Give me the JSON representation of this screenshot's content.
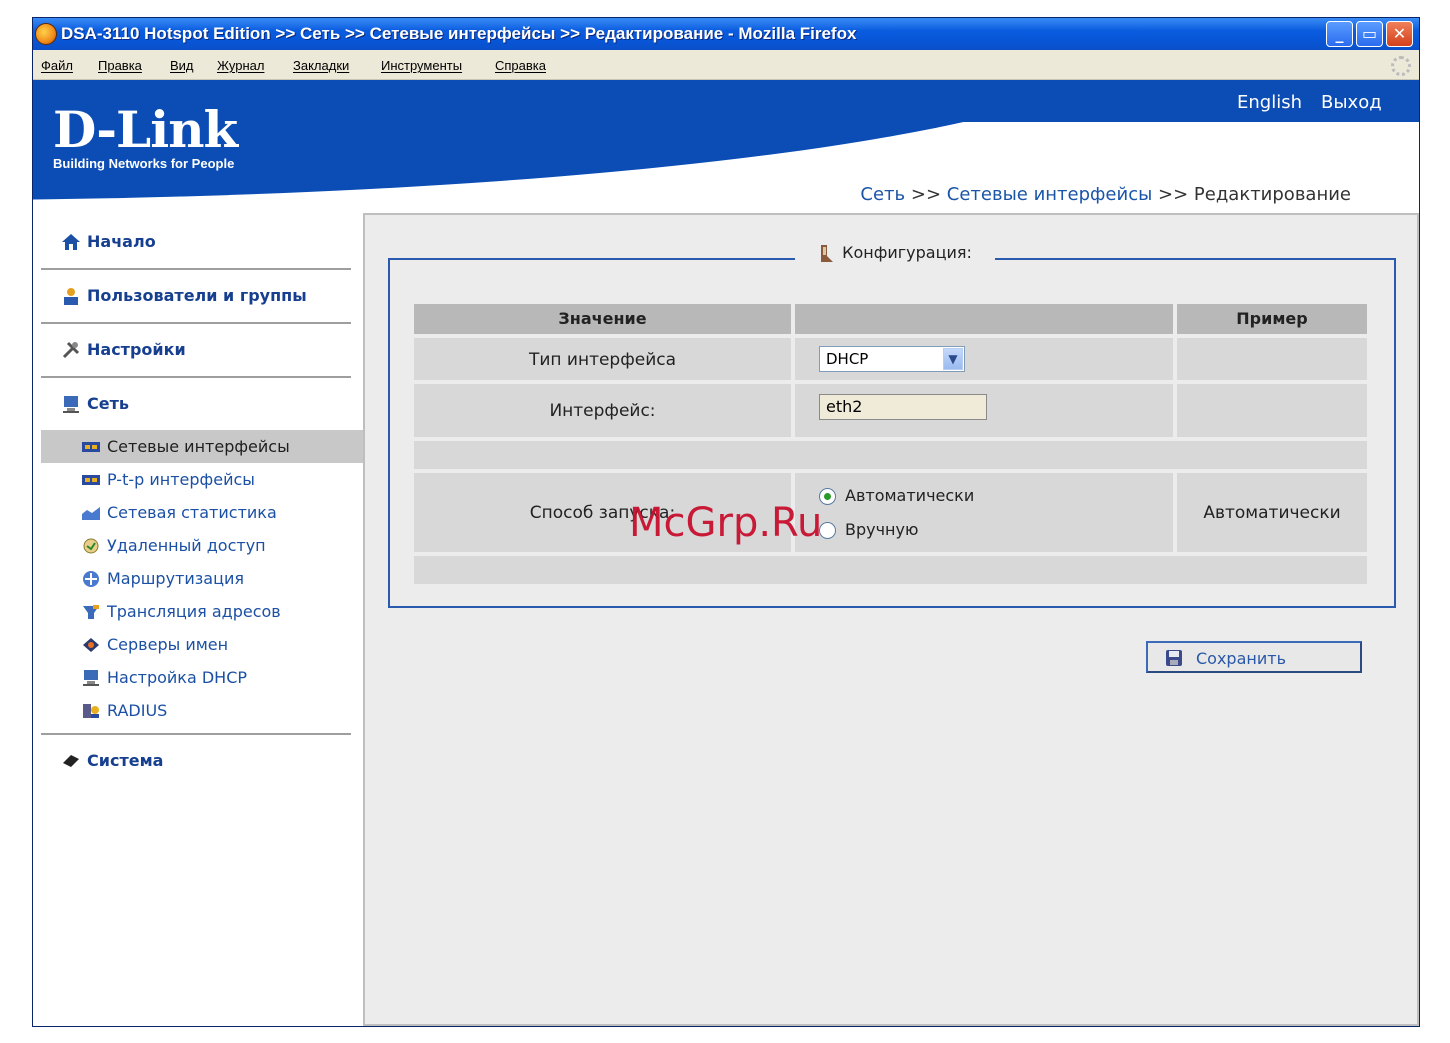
{
  "window": {
    "title": "DSA-3110 Hotspot Edition >> Сеть >> Сетевые интерфейсы >> Редактирование - Mozilla Firefox"
  },
  "menu": [
    "Файл",
    "Правка",
    "Вид",
    "Журнал",
    "Закладки",
    "Инструменты",
    "Справка"
  ],
  "header": {
    "logo": "D-Link",
    "tagline": "Building Networks for People",
    "lang_link": "English",
    "logout_link": "Выход"
  },
  "breadcrumb": {
    "part1": "Сеть",
    "sep1": " >> ",
    "part2": "Сетевые интерфейсы",
    "sep2": " >> ",
    "part3": "Редактирование"
  },
  "sidebar": {
    "home": "Начало",
    "users": "Пользователи и группы",
    "settings": "Настройки",
    "network": "Сеть",
    "network_items": [
      "Сетевые интерфейсы",
      "P-t-p интерфейсы",
      "Сетевая статистика",
      "Удаленный доступ",
      "Маршрутизация",
      "Трансляция адресов",
      "Серверы имен",
      "Настройка DHCP",
      "RADIUS"
    ],
    "system": "Система"
  },
  "config": {
    "legend": "Конфигурация:",
    "col_value": "Значение",
    "col_example": "Пример",
    "iface_type_label": "Тип интерфейса",
    "iface_type_value": "DHCP",
    "iface_label": "Интерфейс:",
    "iface_value": "eth2",
    "start_label": "Способ запуска:",
    "start_auto": "Автоматически",
    "start_manual": "Вручную",
    "start_example": "Автоматически"
  },
  "save_label": "Сохранить",
  "watermark": "McGrp.Ru",
  "colors": {
    "brand_blue": "#0b4db5",
    "link_blue": "#1b50a5",
    "panel_bg": "#ececec"
  }
}
